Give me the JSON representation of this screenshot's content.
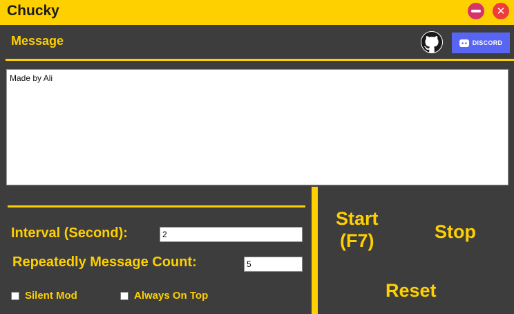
{
  "window": {
    "title": "Chucky",
    "minimize_icon": "minus-circle-icon",
    "close_icon": "close-icon",
    "accent_color": "#ffd000"
  },
  "header": {
    "section_label": "Message",
    "github_icon": "github-icon",
    "discord_label": "DISCORD",
    "discord_color": "#5865f2"
  },
  "message": {
    "value": "Made by Ali"
  },
  "settings": {
    "interval_label": "Interval (Second):",
    "interval_value": "2",
    "count_label": "Repeatedly Message Count:",
    "count_value": "5",
    "silent_label": "Silent Mod",
    "on_top_label": "Always On Top"
  },
  "actions": {
    "start_line1": "Start",
    "start_line2": "(F7)",
    "stop_label": "Stop",
    "reset_label": "Reset"
  }
}
